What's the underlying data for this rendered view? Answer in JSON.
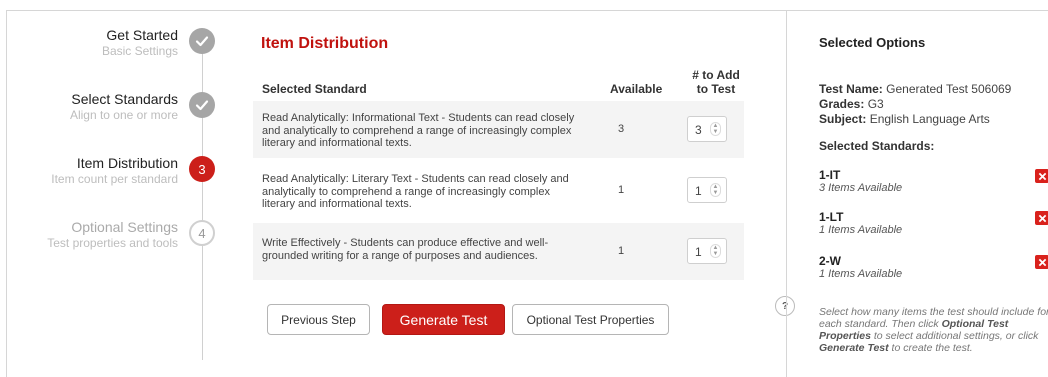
{
  "steps": [
    {
      "title": "Get Started",
      "subtitle": "Basic Settings",
      "state": "done",
      "number": ""
    },
    {
      "title": "Select Standards",
      "subtitle": "Align to one or more",
      "state": "done",
      "number": ""
    },
    {
      "title": "Item Distribution",
      "subtitle": "Item count per standard",
      "state": "active",
      "number": "3"
    },
    {
      "title": "Optional Settings",
      "subtitle": "Test properties and tools",
      "state": "future",
      "number": "4"
    }
  ],
  "main": {
    "title": "Item Distribution",
    "columns": {
      "standard": "Selected Standard",
      "available": "Available",
      "add_line1": "# to Add",
      "add_line2": "to Test"
    },
    "rows": [
      {
        "description": "Read Analytically: Informational Text - Students can read closely and analytically to comprehend a range of increasingly complex literary and informational texts.",
        "available": "3",
        "value": "3"
      },
      {
        "description": "Read Analytically: Literary Text - Students can read closely and analytically to comprehend a range of increasingly complex literary and informational texts.",
        "available": "1",
        "value": "1"
      },
      {
        "description": "Write Effectively - Students can produce effective and well-grounded writing for a range of purposes and audiences.",
        "available": "1",
        "value": "1"
      }
    ],
    "buttons": {
      "previous": "Previous Step",
      "generate": "Generate Test",
      "optional": "Optional Test Properties"
    }
  },
  "panel": {
    "title": "Selected Options",
    "test_name_label": "Test Name:",
    "test_name": "Generated Test 506069",
    "grades_label": "Grades:",
    "grades": "G3",
    "subject_label": "Subject:",
    "subject": "English Language Arts",
    "standards_title": "Selected Standards:",
    "standards": [
      {
        "code": "1-IT",
        "available": "3 Items Available"
      },
      {
        "code": "1-LT",
        "available": "1 Items Available"
      },
      {
        "code": "2-W",
        "available": "1 Items Available"
      }
    ],
    "help_icon": "?",
    "help_1": "Select how many items the test should include for each standard. Then click ",
    "help_b1": "Optional Test Properties",
    "help_2": " to select additional settings, or click ",
    "help_b2": "Generate Test",
    "help_3": " to create the test."
  },
  "colors": {
    "accent": "#cc1f1a",
    "done": "#a6a6a6"
  }
}
